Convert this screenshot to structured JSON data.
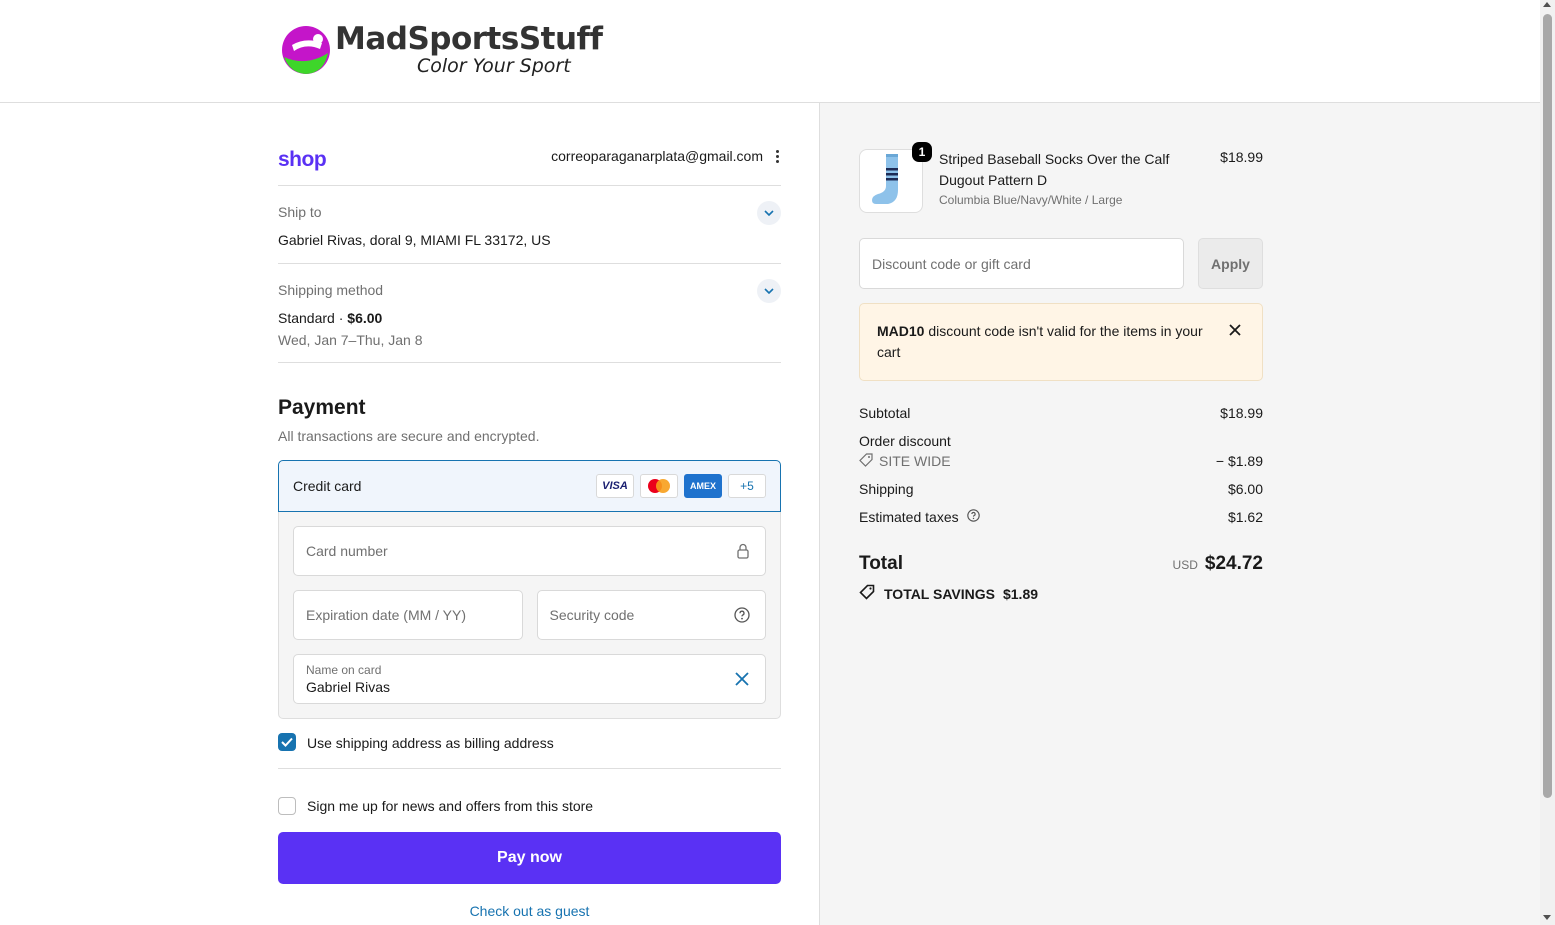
{
  "store": {
    "name": "MadSportsStuff",
    "tagline": "Color Your Sport"
  },
  "account": {
    "shop_logo": "shop",
    "email": "correoparaganarplata@gmail.com"
  },
  "ship_to": {
    "label": "Ship to",
    "value": "Gabriel Rivas, doral 9, MIAMI FL 33172, US"
  },
  "shipping_method": {
    "label": "Shipping method",
    "name": "Standard",
    "separator": " · ",
    "price": "$6.00",
    "eta": "Wed, Jan 7–Thu, Jan 8"
  },
  "payment": {
    "title": "Payment",
    "subtitle": "All transactions are secure and encrypted.",
    "method_label": "Credit card",
    "card_brands": [
      "VISA",
      "",
      "AMEX",
      "+5"
    ],
    "card_number_placeholder": "Card number",
    "expiration_placeholder": "Expiration date (MM / YY)",
    "security_placeholder": "Security code",
    "name_label": "Name on card",
    "name_value": "Gabriel Rivas"
  },
  "billing_checkbox": {
    "label": "Use shipping address as billing address",
    "checked": true
  },
  "newsletter_checkbox": {
    "label": "Sign me up for news and offers from this store",
    "checked": false
  },
  "pay_button": "Pay now",
  "guest_link": "Check out as guest",
  "cart": {
    "item": {
      "name": "Striped Baseball Socks Over the Calf Dugout Pattern D",
      "variant": "Columbia Blue/Navy/White / Large",
      "price": "$18.99",
      "quantity": "1"
    },
    "discount_placeholder": "Discount code or gift card",
    "apply_label": "Apply",
    "alert": {
      "code": "MAD10",
      "message": " discount code isn't valid for the items in your cart"
    },
    "subtotal_label": "Subtotal",
    "subtotal": "$18.99",
    "order_discount_label": "Order discount",
    "discount_code": "SITE WIDE",
    "discount_amount": "− $1.89",
    "shipping_label": "Shipping",
    "shipping": "$6.00",
    "taxes_label": "Estimated taxes",
    "taxes": "$1.62",
    "total_label": "Total",
    "currency": "USD",
    "total": "$24.72",
    "savings_label": "TOTAL SAVINGS",
    "savings": "$1.89"
  },
  "colors": {
    "primary": "#5a31f4",
    "link": "#1773b0",
    "alert_bg": "#fff5e6"
  }
}
